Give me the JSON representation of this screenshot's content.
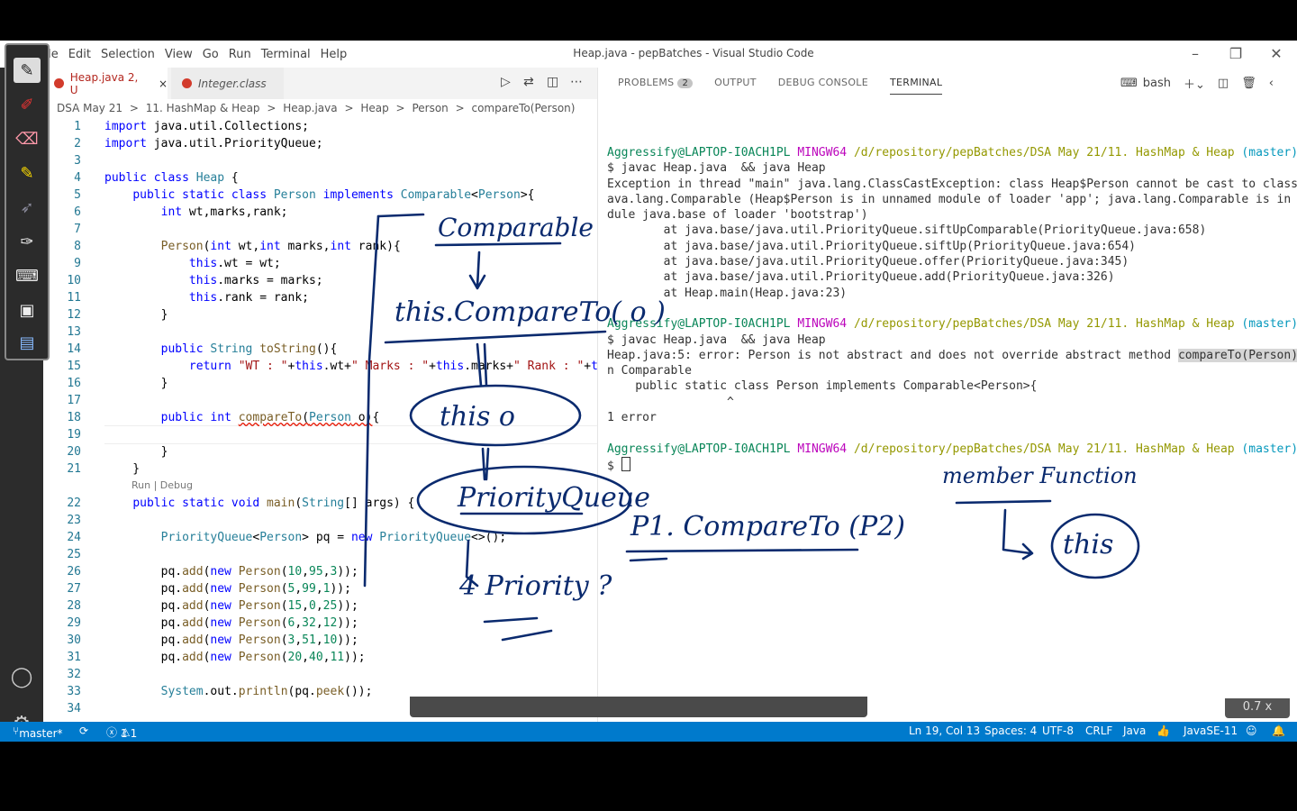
{
  "titlebar": {
    "menu": [
      "File",
      "Edit",
      "Selection",
      "View",
      "Go",
      "Run",
      "Terminal",
      "Help"
    ],
    "window_title": "Heap.java - pepBatches - Visual Studio Code"
  },
  "editor": {
    "tabs": [
      {
        "label": "Heap.java 2, U",
        "close": "×"
      },
      {
        "label": "Integer.class"
      }
    ],
    "breadcrumb": [
      "DSA May 21",
      ">",
      "11. HashMap & Heap",
      ">",
      "Heap.java",
      ">",
      "Heap",
      ">",
      "Person",
      ">",
      "compareTo(Person)"
    ],
    "lens": "Run | Debug"
  },
  "panel": {
    "tabs": [
      {
        "label": "PROBLEMS",
        "badge": "2"
      },
      {
        "label": "OUTPUT"
      },
      {
        "label": "DEBUG CONSOLE"
      },
      {
        "label": "TERMINAL"
      }
    ],
    "shell": "bash",
    "prompt_user": "Aggressify@LAPTOP-I0ACH1PL",
    "prompt_host": "MINGW64",
    "prompt_path": "/d/repository/pepBatches/DSA May 21/11. HashMap & Heap",
    "prompt_branch": "(master)",
    "cmd1": "$ javac Heap.java  && java Heap",
    "exc1": "Exception in thread \"main\" java.lang.ClassCastException: class Heap$Person cannot be cast to class j",
    "exc2": "ava.lang.Comparable (Heap$Person is in unnamed module of loader 'app'; java.lang.Comparable is in mo",
    "exc3": "dule java.base of loader 'bootstrap')",
    "st1": "        at java.base/java.util.PriorityQueue.siftUpComparable(PriorityQueue.java:658)",
    "st2": "        at java.base/java.util.PriorityQueue.siftUp(PriorityQueue.java:654)",
    "st3": "        at java.base/java.util.PriorityQueue.offer(PriorityQueue.java:345)",
    "st4": "        at java.base/java.util.PriorityQueue.add(PriorityQueue.java:326)",
    "st5": "        at Heap.main(Heap.java:23)",
    "cmd2": "$ javac Heap.java  && java Heap",
    "err1a": "Heap.java:5: error: Person is not abstract and does not override abstract method ",
    "err1b": "compareTo(Person)",
    "err1c": " i",
    "err2": "n Comparable",
    "err3": "    public static class Person implements Comparable<Person>{",
    "err4": "                 ^",
    "err5": "1 error",
    "cmd3": "$ "
  },
  "statusbar": {
    "branch": "master*",
    "errors": "1",
    "warnings": "1",
    "position": "Ln 19, Col 13",
    "spaces": "Spaces: 4",
    "encoding": "UTF-8",
    "eol": "CRLF",
    "language": "Java",
    "java_version": "JavaSE-11"
  },
  "zoom": "0.7 x",
  "ink": {
    "comparable": "Comparable",
    "compareto": "this.CompareTo( o )",
    "this_o": "this    o",
    "priorityqueue": "PriorityQueue",
    "priority": "4 Priority ?",
    "p1": "P1. CompareTo (P2)",
    "member": "member Function",
    "this": "this"
  },
  "colors": {
    "accent": "#007acc",
    "ink": "#0a2a6e"
  }
}
